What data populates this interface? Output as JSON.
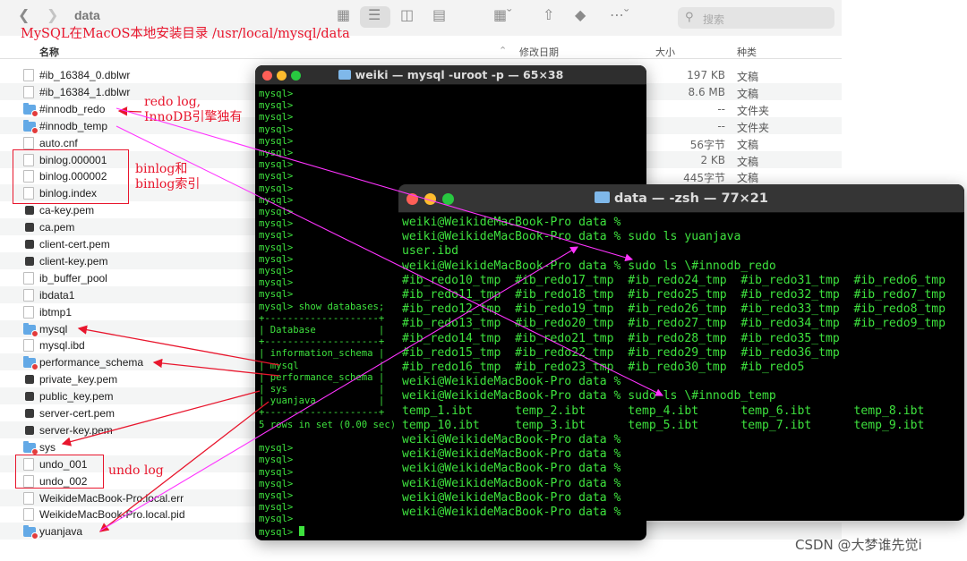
{
  "finder": {
    "title": "data",
    "search_placeholder": "搜索",
    "columns": {
      "name": "名称",
      "modified": "修改日期",
      "size": "大小",
      "kind": "种类"
    },
    "rows": [
      {
        "name": "#ib_16384_0.dblwr",
        "size": "197 KB",
        "kind": "文稿",
        "icon": "doc"
      },
      {
        "name": "#ib_16384_1.dblwr",
        "size": "8.6 MB",
        "kind": "文稿",
        "icon": "doc"
      },
      {
        "name": "#innodb_redo",
        "size": "--",
        "kind": "文件夹",
        "icon": "folder-locked"
      },
      {
        "name": "#innodb_temp",
        "size": "--",
        "kind": "文件夹",
        "icon": "folder-locked"
      },
      {
        "name": "auto.cnf",
        "size": "56字节",
        "kind": "文稿",
        "icon": "doc"
      },
      {
        "name": "binlog.000001",
        "size": "2 KB",
        "kind": "文稿",
        "icon": "doc"
      },
      {
        "name": "binlog.000002",
        "size": "445字节",
        "kind": "文稿",
        "icon": "doc"
      },
      {
        "name": "binlog.index",
        "size": "",
        "kind": "",
        "icon": "doc"
      },
      {
        "name": "ca-key.pem",
        "size": "",
        "kind": "",
        "icon": "key"
      },
      {
        "name": "ca.pem",
        "size": "",
        "kind": "",
        "icon": "key"
      },
      {
        "name": "client-cert.pem",
        "size": "",
        "kind": "",
        "icon": "key"
      },
      {
        "name": "client-key.pem",
        "size": "",
        "kind": "",
        "icon": "key"
      },
      {
        "name": "ib_buffer_pool",
        "size": "",
        "kind": "",
        "icon": "doc"
      },
      {
        "name": "ibdata1",
        "size": "",
        "kind": "",
        "icon": "doc"
      },
      {
        "name": "ibtmp1",
        "size": "",
        "kind": "",
        "icon": "doc"
      },
      {
        "name": "mysql",
        "size": "",
        "kind": "",
        "icon": "folder-locked"
      },
      {
        "name": "mysql.ibd",
        "size": "",
        "kind": "",
        "icon": "doc"
      },
      {
        "name": "performance_schema",
        "size": "",
        "kind": "",
        "icon": "folder-locked"
      },
      {
        "name": "private_key.pem",
        "size": "",
        "kind": "",
        "icon": "key"
      },
      {
        "name": "public_key.pem",
        "size": "",
        "kind": "",
        "icon": "key"
      },
      {
        "name": "server-cert.pem",
        "size": "",
        "kind": "",
        "icon": "key"
      },
      {
        "name": "server-key.pem",
        "size": "",
        "kind": "",
        "icon": "key"
      },
      {
        "name": "sys",
        "size": "",
        "kind": "",
        "icon": "folder-locked"
      },
      {
        "name": "undo_001",
        "size": "",
        "kind": "",
        "icon": "doc"
      },
      {
        "name": "undo_002",
        "size": "",
        "kind": "",
        "icon": "doc"
      },
      {
        "name": "WeikideMacBook-Pro.local.err",
        "size": "",
        "kind": "",
        "icon": "doc"
      },
      {
        "name": "WeikideMacBook-Pro.local.pid",
        "size": "",
        "kind": "",
        "icon": "doc"
      },
      {
        "name": "yuanjava",
        "size": "",
        "kind": "",
        "icon": "folder-locked"
      }
    ]
  },
  "annotations": {
    "install_dir": "MySQL在MacOS本地安装目录 /usr/local/mysql/data",
    "redo_line1": "redo log,",
    "redo_line2": "InnoDB引擎独有",
    "binlog_line1": "binlog和",
    "binlog_line2": "binlog索引",
    "undo": "undo log"
  },
  "terminal1": {
    "title": "weiki — mysql -uroot -p — 65×38",
    "lines": [
      "mysql>",
      "mysql>",
      "mysql>",
      "mysql>",
      "mysql>",
      "mysql>",
      "mysql>",
      "mysql>",
      "mysql>",
      "mysql>",
      "mysql>",
      "mysql>",
      "mysql>",
      "mysql>",
      "mysql>",
      "mysql>",
      "mysql>",
      "mysql>",
      "mysql> show databases;",
      "+--------------------+",
      "| Database           |",
      "+--------------------+",
      "| information_schema |",
      "| mysql              |",
      "| performance_schema |",
      "| sys                |",
      "| yuanjava           |",
      "+--------------------+",
      "5 rows in set (0.00 sec)",
      "",
      "mysql>",
      "mysql>",
      "mysql>",
      "mysql>",
      "mysql>",
      "mysql>",
      "mysql>",
      "mysql> "
    ]
  },
  "terminal2": {
    "title": "data — -zsh — 77×21",
    "lines": [
      "weiki@WeikideMacBook-Pro data %",
      "weiki@WeikideMacBook-Pro data % sudo ls yuanjava",
      "user.ibd",
      "weiki@WeikideMacBook-Pro data % sudo ls \\#innodb_redo",
      "#ib_redo10_tmp  #ib_redo17_tmp  #ib_redo24_tmp  #ib_redo31_tmp  #ib_redo6_tmp",
      "#ib_redo11_tmp  #ib_redo18_tmp  #ib_redo25_tmp  #ib_redo32_tmp  #ib_redo7_tmp",
      "#ib_redo12_tmp  #ib_redo19_tmp  #ib_redo26_tmp  #ib_redo33_tmp  #ib_redo8_tmp",
      "#ib_redo13_tmp  #ib_redo20_tmp  #ib_redo27_tmp  #ib_redo34_tmp  #ib_redo9_tmp",
      "#ib_redo14_tmp  #ib_redo21_tmp  #ib_redo28_tmp  #ib_redo35_tmp",
      "#ib_redo15_tmp  #ib_redo22_tmp  #ib_redo29_tmp  #ib_redo36_tmp",
      "#ib_redo16_tmp  #ib_redo23_tmp  #ib_redo30_tmp  #ib_redo5",
      "weiki@WeikideMacBook-Pro data %",
      "weiki@WeikideMacBook-Pro data % sudo ls \\#innodb_temp",
      "temp_1.ibt      temp_2.ibt      temp_4.ibt      temp_6.ibt      temp_8.ibt",
      "temp_10.ibt     temp_3.ibt      temp_5.ibt      temp_7.ibt      temp_9.ibt",
      "weiki@WeikideMacBook-Pro data %",
      "weiki@WeikideMacBook-Pro data %",
      "weiki@WeikideMacBook-Pro data %",
      "weiki@WeikideMacBook-Pro data %",
      "weiki@WeikideMacBook-Pro data %",
      "weiki@WeikideMacBook-Pro data %"
    ]
  },
  "watermark": "CSDN @大梦谁先觉i",
  "colors": {
    "annotation_red": "#e8162d",
    "arrow_magenta": "#ff33ff",
    "terminal_green": "#3ee23e"
  }
}
